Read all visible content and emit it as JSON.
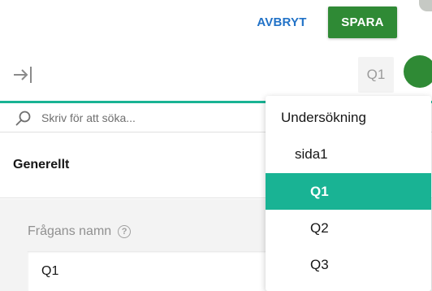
{
  "header": {
    "cancel_label": "AVBRYT",
    "save_label": "SPARA"
  },
  "toolbar": {
    "current_question_chip": "Q1"
  },
  "search": {
    "placeholder": "Skriv för att söka..."
  },
  "section": {
    "title": "Generellt"
  },
  "question_name_field": {
    "label": "Frågans namn",
    "help_icon": "?",
    "value": "Q1"
  },
  "dropdown": {
    "items": [
      {
        "label": "Undersökning",
        "level": 0
      },
      {
        "label": "sida1",
        "level": 1
      },
      {
        "label": "Q1",
        "level": 2,
        "selected": true
      },
      {
        "label": "Q2",
        "level": 2
      },
      {
        "label": "Q3",
        "level": 2
      }
    ]
  },
  "colors": {
    "accent": "#19b394",
    "save": "#2f8a35",
    "link": "#2172c7"
  }
}
